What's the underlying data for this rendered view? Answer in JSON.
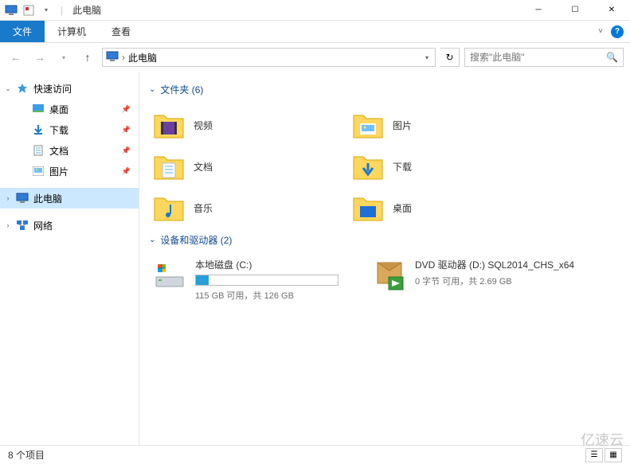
{
  "titlebar": {
    "separator": "|",
    "title": "此电脑"
  },
  "ribbon": {
    "file": "文件",
    "computer": "计算机",
    "view": "查看"
  },
  "nav": {
    "back": "←",
    "forward": "→",
    "up": "↑"
  },
  "address": {
    "chevron": "›",
    "location": "此电脑",
    "refresh": "↻"
  },
  "search": {
    "placeholder": "搜索\"此电脑\"",
    "icon": "🔍"
  },
  "sidebar": {
    "quick_access": "快速访问",
    "items": [
      {
        "label": "桌面",
        "icon": "desktop"
      },
      {
        "label": "下载",
        "icon": "downloads"
      },
      {
        "label": "文档",
        "icon": "documents"
      },
      {
        "label": "图片",
        "icon": "pictures"
      }
    ],
    "this_pc": "此电脑",
    "network": "网络"
  },
  "content": {
    "folders_header": "文件夹 (6)",
    "folders": [
      {
        "label": "视频",
        "icon": "videos"
      },
      {
        "label": "图片",
        "icon": "pictures"
      },
      {
        "label": "文档",
        "icon": "documents"
      },
      {
        "label": "下载",
        "icon": "downloads"
      },
      {
        "label": "音乐",
        "icon": "music"
      },
      {
        "label": "桌面",
        "icon": "desktop"
      }
    ],
    "devices_header": "设备和驱动器 (2)",
    "drives": [
      {
        "title": "本地磁盘 (C:)",
        "subtitle": "115 GB 可用，共 126 GB",
        "used_percent": 9,
        "icon": "disk"
      },
      {
        "title": "DVD 驱动器 (D:) SQL2014_CHS_x64",
        "subtitle": "0 字节 可用，共 2.69 GB",
        "icon": "dvd"
      }
    ]
  },
  "statusbar": {
    "count": "8 个项目"
  },
  "watermark": "亿速云"
}
